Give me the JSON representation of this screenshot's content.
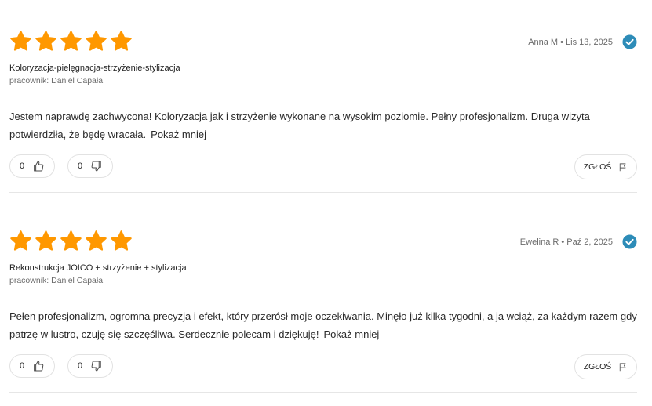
{
  "colors": {
    "star": "#FF9800",
    "verified": "#2D8CB8",
    "border": "#E2E2E2"
  },
  "reviews": [
    {
      "rating": 5,
      "author_date": "Anna M • Lis 13, 2025",
      "service": "Koloryzacja-pielęgnacja-strzyżenie-stylizacja",
      "employee": "pracownik: Daniel Capała",
      "text": "Jestem naprawdę zachwycona! Koloryzacja jak i strzyżenie wykonane na wysokim poziomie. Pełny profesjonalizm. Druga wizyta potwierdziła, że będę wracała.",
      "show_less": "Pokaż mniej",
      "likes": "0",
      "dislikes": "0",
      "report_label": "ZGŁOŚ"
    },
    {
      "rating": 5,
      "author_date": "Ewelina R • Paź 2, 2025",
      "service": "Rekonstrukcja JOICO + strzyżenie + stylizacja",
      "employee": "pracownik: Daniel Capała",
      "text": "Pełen profesjonalizm, ogromna precyzja i efekt, który przerósł moje oczekiwania. Minęło już kilka tygodni, a ja wciąż, za każdym razem gdy patrzę w lustro, czuję się szczęśliwa. Serdecznie polecam i dziękuję!",
      "show_less": "Pokaż mniej",
      "likes": "0",
      "dislikes": "0",
      "report_label": "ZGŁOŚ"
    }
  ]
}
